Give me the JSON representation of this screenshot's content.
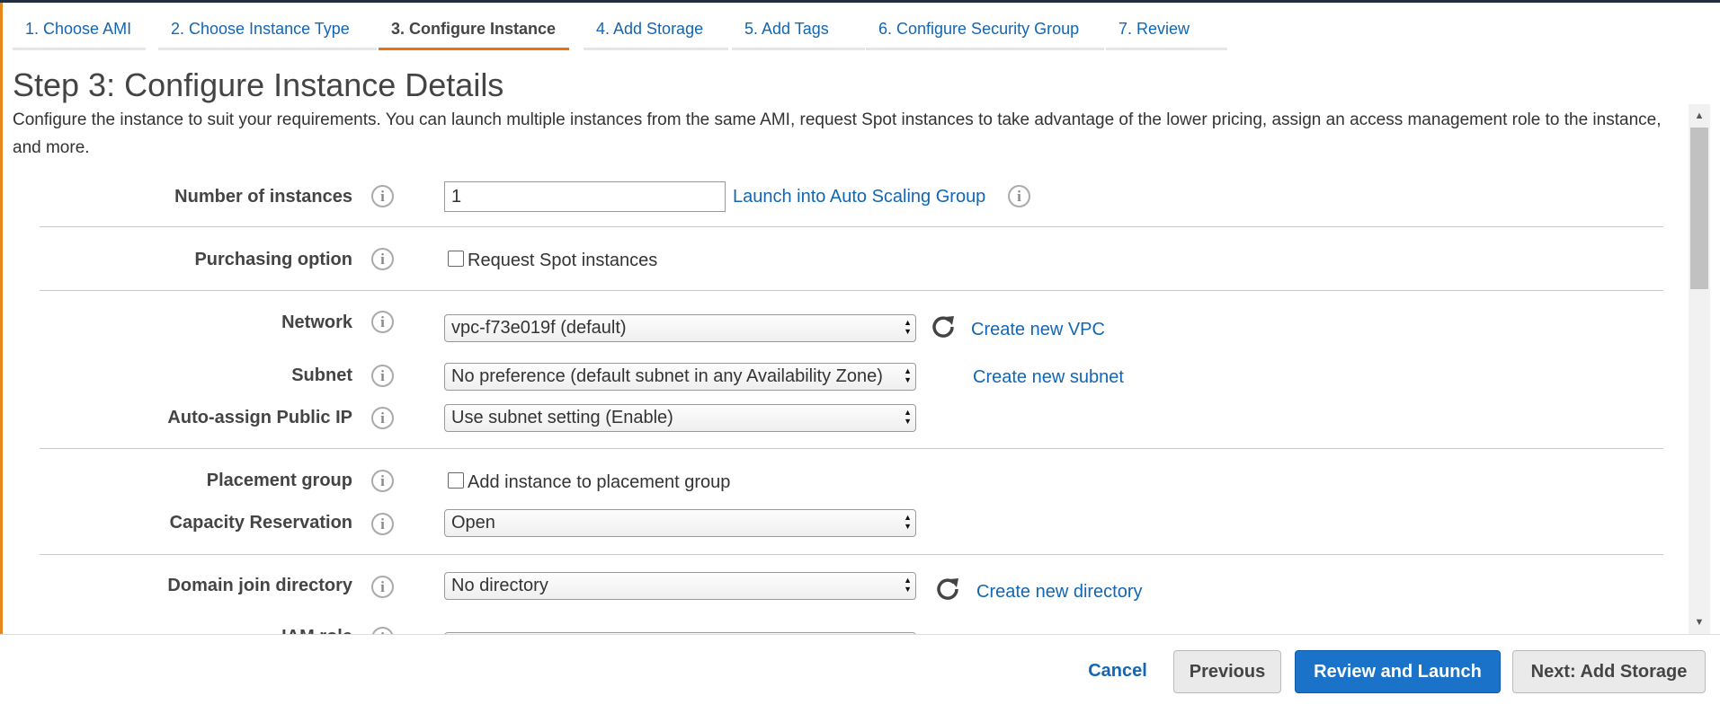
{
  "wizard_tabs": [
    {
      "label": "1. Choose AMI"
    },
    {
      "label": "2. Choose Instance Type"
    },
    {
      "label": "3. Configure Instance"
    },
    {
      "label": "4. Add Storage"
    },
    {
      "label": "5. Add Tags"
    },
    {
      "label": "6. Configure Security Group"
    },
    {
      "label": "7. Review"
    }
  ],
  "page": {
    "title": "Step 3: Configure Instance Details",
    "description": "Configure the instance to suit your requirements. You can launch multiple instances from the same AMI, request Spot instances to take advantage of the lower pricing, assign an access management role to the instance, and more."
  },
  "info_icon_glyph": "i",
  "form": {
    "number_of_instances": {
      "label": "Number of instances",
      "value": "1",
      "link": "Launch into Auto Scaling Group"
    },
    "purchasing_option": {
      "label": "Purchasing option",
      "checkbox_label": "Request Spot instances",
      "checked": false
    },
    "network": {
      "label": "Network",
      "value": "vpc-f73e019f (default)",
      "link": "Create new VPC"
    },
    "subnet": {
      "label": "Subnet",
      "value": "No preference (default subnet in any Availability Zone)",
      "link": "Create new subnet"
    },
    "auto_assign_public_ip": {
      "label": "Auto-assign Public IP",
      "value": "Use subnet setting (Enable)"
    },
    "placement_group": {
      "label": "Placement group",
      "checkbox_label": "Add instance to placement group",
      "checked": false
    },
    "capacity_reservation": {
      "label": "Capacity Reservation",
      "value": "Open"
    },
    "domain_join_directory": {
      "label": "Domain join directory",
      "value": "No directory",
      "link": "Create new directory"
    },
    "iam_role": {
      "label": "IAM role"
    }
  },
  "footer": {
    "cancel": "Cancel",
    "previous": "Previous",
    "review_and_launch": "Review and Launch",
    "next": "Next: Add Storage"
  },
  "colors": {
    "accent": "#ec7211",
    "link": "#1266b3",
    "primary_button": "#1a73c9"
  }
}
